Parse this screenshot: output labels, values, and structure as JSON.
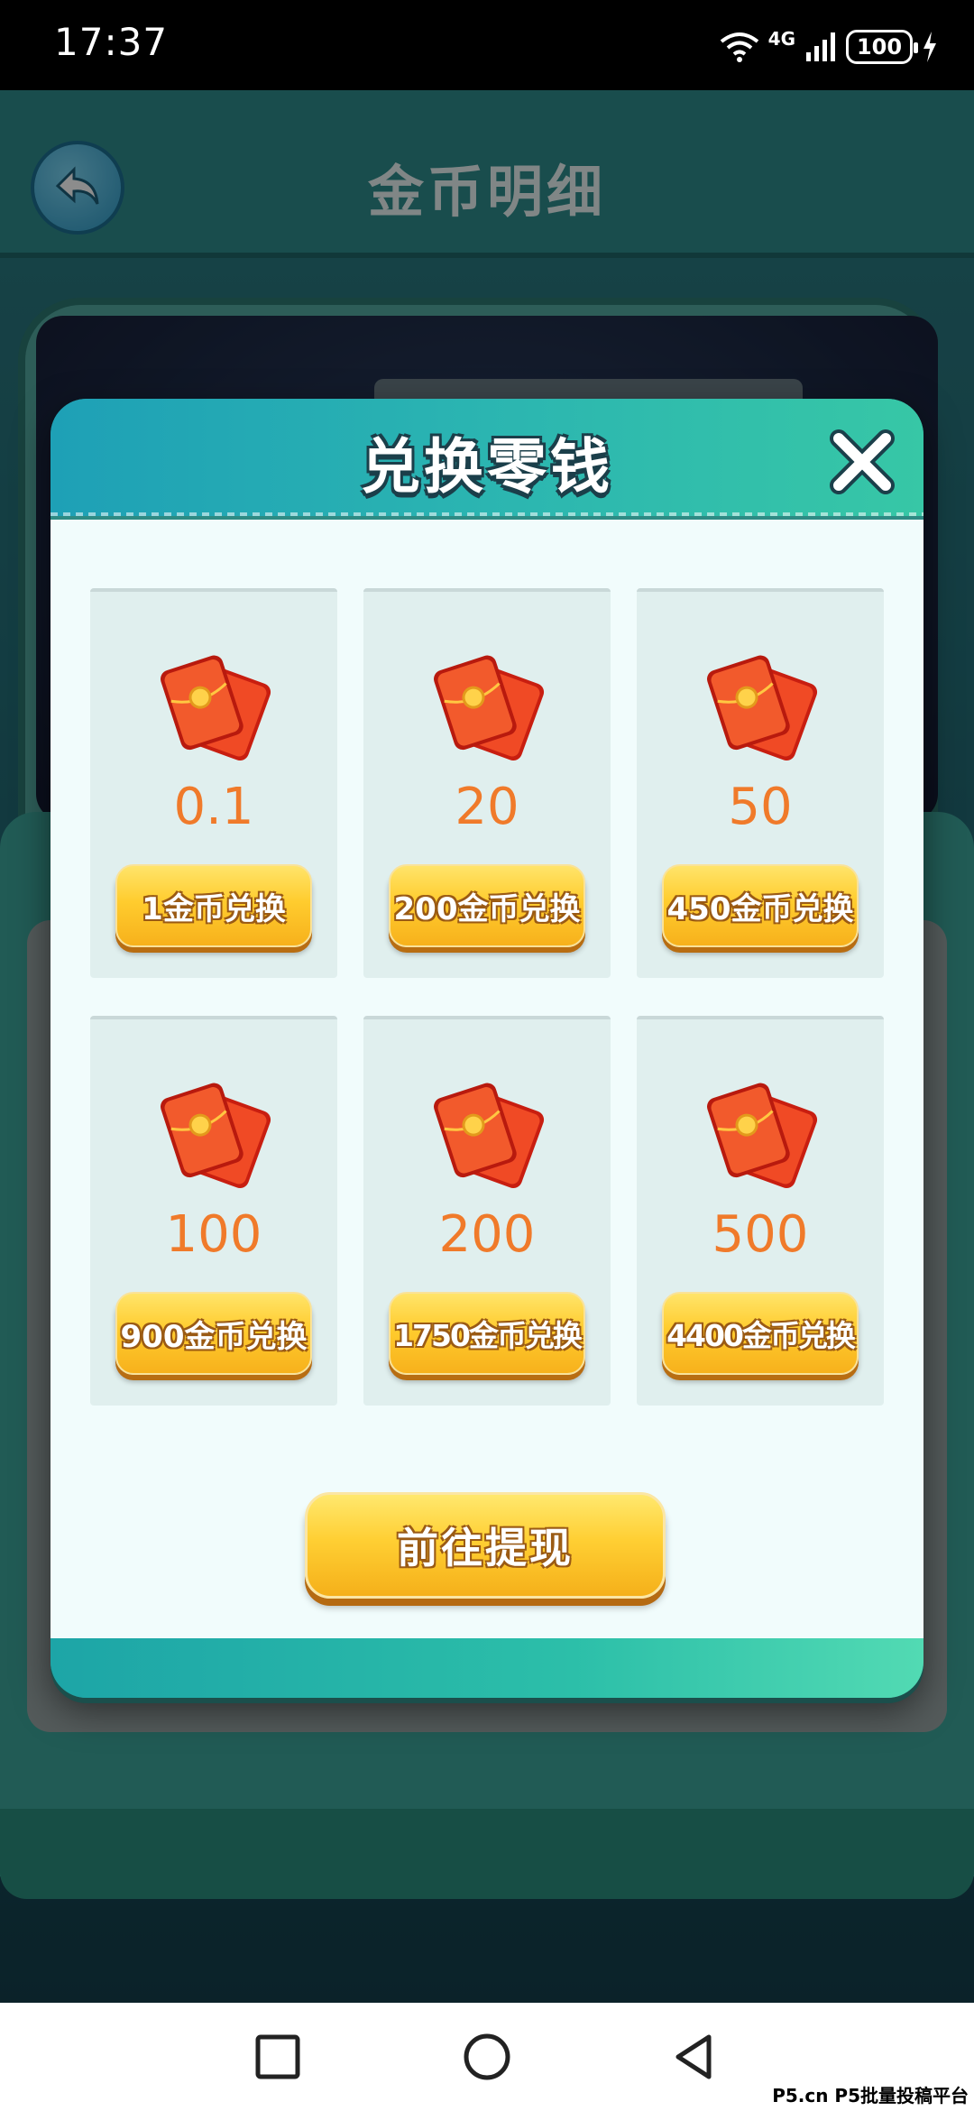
{
  "status_bar": {
    "time": "17:37",
    "network_label": "4G",
    "battery": "100",
    "icons": [
      "wifi-icon",
      "signal-icon",
      "battery-icon",
      "charging-icon"
    ]
  },
  "background_app": {
    "title": "金币明细",
    "back_icon": "back-arrow-icon"
  },
  "modal": {
    "title": "兑换零钱",
    "close_icon": "close-icon",
    "options": [
      {
        "amount": "0.1",
        "button_label": "1金币兑换"
      },
      {
        "amount": "20",
        "button_label": "200金币兑换"
      },
      {
        "amount": "50",
        "button_label": "450金币兑换"
      },
      {
        "amount": "100",
        "button_label": "900金币兑换"
      },
      {
        "amount": "200",
        "button_label": "1750金币兑换"
      },
      {
        "amount": "500",
        "button_label": "4400金币兑换"
      }
    ],
    "withdraw_label": "前往提现"
  },
  "navigation": {
    "buttons": [
      "recents-square-icon",
      "home-circle-icon",
      "back-triangle-icon"
    ]
  },
  "watermark": "P5.cn P5批量投稿平台",
  "colors": {
    "accent_teal": "#2bb5b1",
    "amount_orange": "#f07a2a",
    "button_gold": "#ffcc2e"
  }
}
